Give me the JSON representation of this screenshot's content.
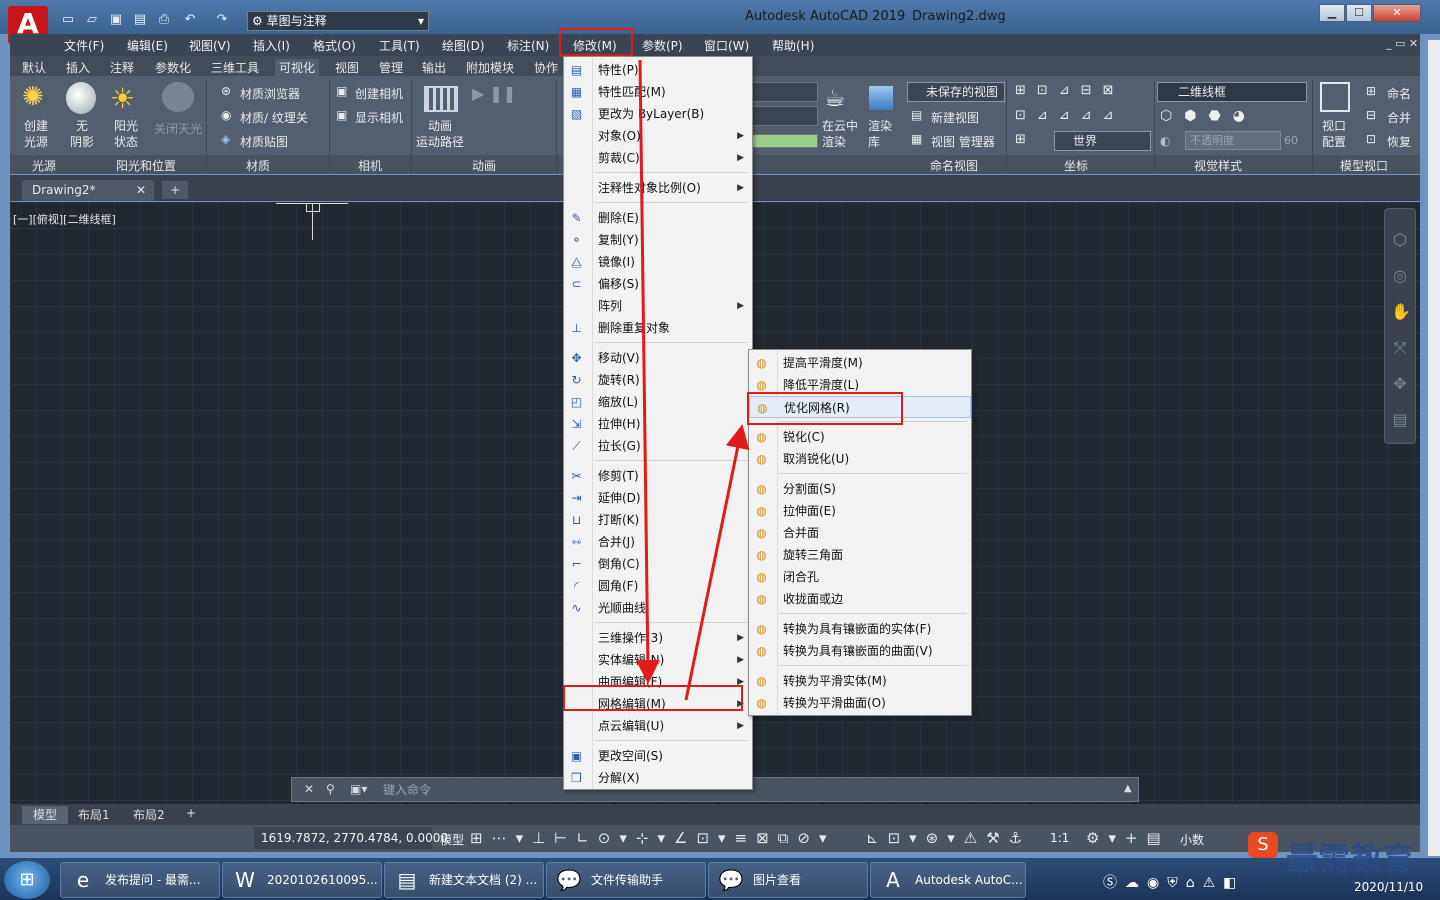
{
  "window": {
    "title": "Autodesk AutoCAD 2019",
    "file": "Drawing2.dwg",
    "workspace": "草图与注释",
    "min": "▁",
    "max": "☐",
    "close": "✕"
  },
  "menubar": [
    "文件(F)",
    "编辑(E)",
    "视图(V)",
    "插入(I)",
    "格式(O)",
    "工具(T)",
    "绘图(D)",
    "标注(N)",
    "修改(M)",
    "参数(P)",
    "窗口(W)",
    "帮助(H)"
  ],
  "ribbon_tabs": [
    "默认",
    "插入",
    "注释",
    "参数化",
    "三维工具",
    "可视化",
    "视图",
    "管理",
    "输出",
    "附加模块",
    "协作"
  ],
  "ribbon": {
    "lights": {
      "create": "创建\n光源",
      "no_shadow": "无\n阴影",
      "sun_status": "阳光\n状态",
      "sun_off": "关闭天光"
    },
    "materials": [
      "材质浏览器",
      "材质/ 纹理关",
      "材质贴图"
    ],
    "camera": [
      "创建相机",
      "显示相机"
    ],
    "animation": "动画\n运动路径",
    "render": [
      "在云中\n渲染",
      "渲染\n库"
    ],
    "views": [
      "未保存的视图",
      "新建视图",
      "视图 管理器"
    ],
    "ucs_world": "世界",
    "visual_style": "二维线框",
    "opacity": "不透明度",
    "opacity_val": "60",
    "viewport": [
      "视口\n配置",
      "命名",
      "合并",
      "恢复"
    ],
    "groups": [
      "光源",
      "阳光和位置",
      "材质",
      "相机",
      "动画",
      "命名视图",
      "坐标",
      "视觉样式",
      "模型视口"
    ]
  },
  "doc_tab": "Drawing2*",
  "view_label": "[一][俯视][二维线框]",
  "modify_menu": [
    {
      "label": "特性(P)",
      "icon": "▤"
    },
    {
      "label": "特性匹配(M)",
      "icon": "▦"
    },
    {
      "label": "更改为 ByLayer(B)",
      "icon": "▧"
    },
    {
      "label": "对象(O)",
      "sub": true
    },
    {
      "label": "剪裁(C)",
      "sub": true
    },
    {
      "sep": true
    },
    {
      "label": "注释性对象比例(O)",
      "sub": true
    },
    {
      "sep": true
    },
    {
      "label": "删除(E)",
      "icon": "✎"
    },
    {
      "label": "复制(Y)",
      "icon": "⚬"
    },
    {
      "label": "镜像(I)",
      "icon": "⧋"
    },
    {
      "label": "偏移(S)",
      "icon": "⊂"
    },
    {
      "label": "阵列",
      "sub": true
    },
    {
      "label": "删除重复对象",
      "icon": "⊥"
    },
    {
      "sep": true
    },
    {
      "label": "移动(V)",
      "icon": "✥"
    },
    {
      "label": "旋转(R)",
      "icon": "↻"
    },
    {
      "label": "缩放(L)",
      "icon": "◰"
    },
    {
      "label": "拉伸(H)",
      "icon": "⇲"
    },
    {
      "label": "拉长(G)",
      "icon": "⟋"
    },
    {
      "sep": true
    },
    {
      "label": "修剪(T)",
      "icon": "✂"
    },
    {
      "label": "延伸(D)",
      "icon": "⇥"
    },
    {
      "label": "打断(K)",
      "icon": "⊔"
    },
    {
      "label": "合并(J)",
      "icon": "⇿"
    },
    {
      "label": "倒角(C)",
      "icon": "⌐"
    },
    {
      "label": "圆角(F)",
      "icon": "◜"
    },
    {
      "label": "光顺曲线",
      "icon": "∿"
    },
    {
      "sep": true
    },
    {
      "label": "三维操作(3)",
      "sub": true
    },
    {
      "label": "实体编辑(N)",
      "sub": true
    },
    {
      "label": "曲面编辑(F)",
      "sub": true
    },
    {
      "label": "网格编辑(M)",
      "sub": true
    },
    {
      "label": "点云编辑(U)",
      "sub": true
    },
    {
      "sep": true
    },
    {
      "label": "更改空间(S)",
      "icon": "▣"
    },
    {
      "label": "分解(X)",
      "icon": "❒"
    }
  ],
  "mesh_menu": [
    {
      "label": "提高平滑度(M)"
    },
    {
      "label": "降低平滑度(L)"
    },
    {
      "label": "优化网格(R)"
    },
    {
      "sep": true
    },
    {
      "label": "锐化(C)"
    },
    {
      "label": "取消锐化(U)"
    },
    {
      "sep": true
    },
    {
      "label": "分割面(S)"
    },
    {
      "label": "拉伸面(E)"
    },
    {
      "label": "合并面"
    },
    {
      "label": "旋转三角面"
    },
    {
      "label": "闭合孔"
    },
    {
      "label": "收拢面或边"
    },
    {
      "sep": true
    },
    {
      "label": "转换为具有镶嵌面的实体(F)"
    },
    {
      "label": "转换为具有镶嵌面的曲面(V)"
    },
    {
      "sep": true
    },
    {
      "label": "转换为平滑实体(M)"
    },
    {
      "label": "转换为平滑曲面(O)"
    }
  ],
  "command": {
    "placeholder": "键入命令"
  },
  "layout_tabs": [
    "模型",
    "布局1",
    "布局2"
  ],
  "status": {
    "coords": "1619.7872, 2770.4784, 0.0000",
    "model": "模型",
    "scale": "1:1",
    "units": "小数"
  },
  "taskbar": [
    "发布提问 - 最需...",
    "2020102610095...",
    "新建文本文档 (2) ...",
    "文件传输助手",
    "图片查看",
    "Autodesk AutoC..."
  ],
  "clock": "2020/11/10",
  "watermark": "最需教育",
  "colors": {
    "accent_red": "#e11a1a",
    "canvas": "#212830",
    "menu_bg": "#f2f2f2"
  }
}
